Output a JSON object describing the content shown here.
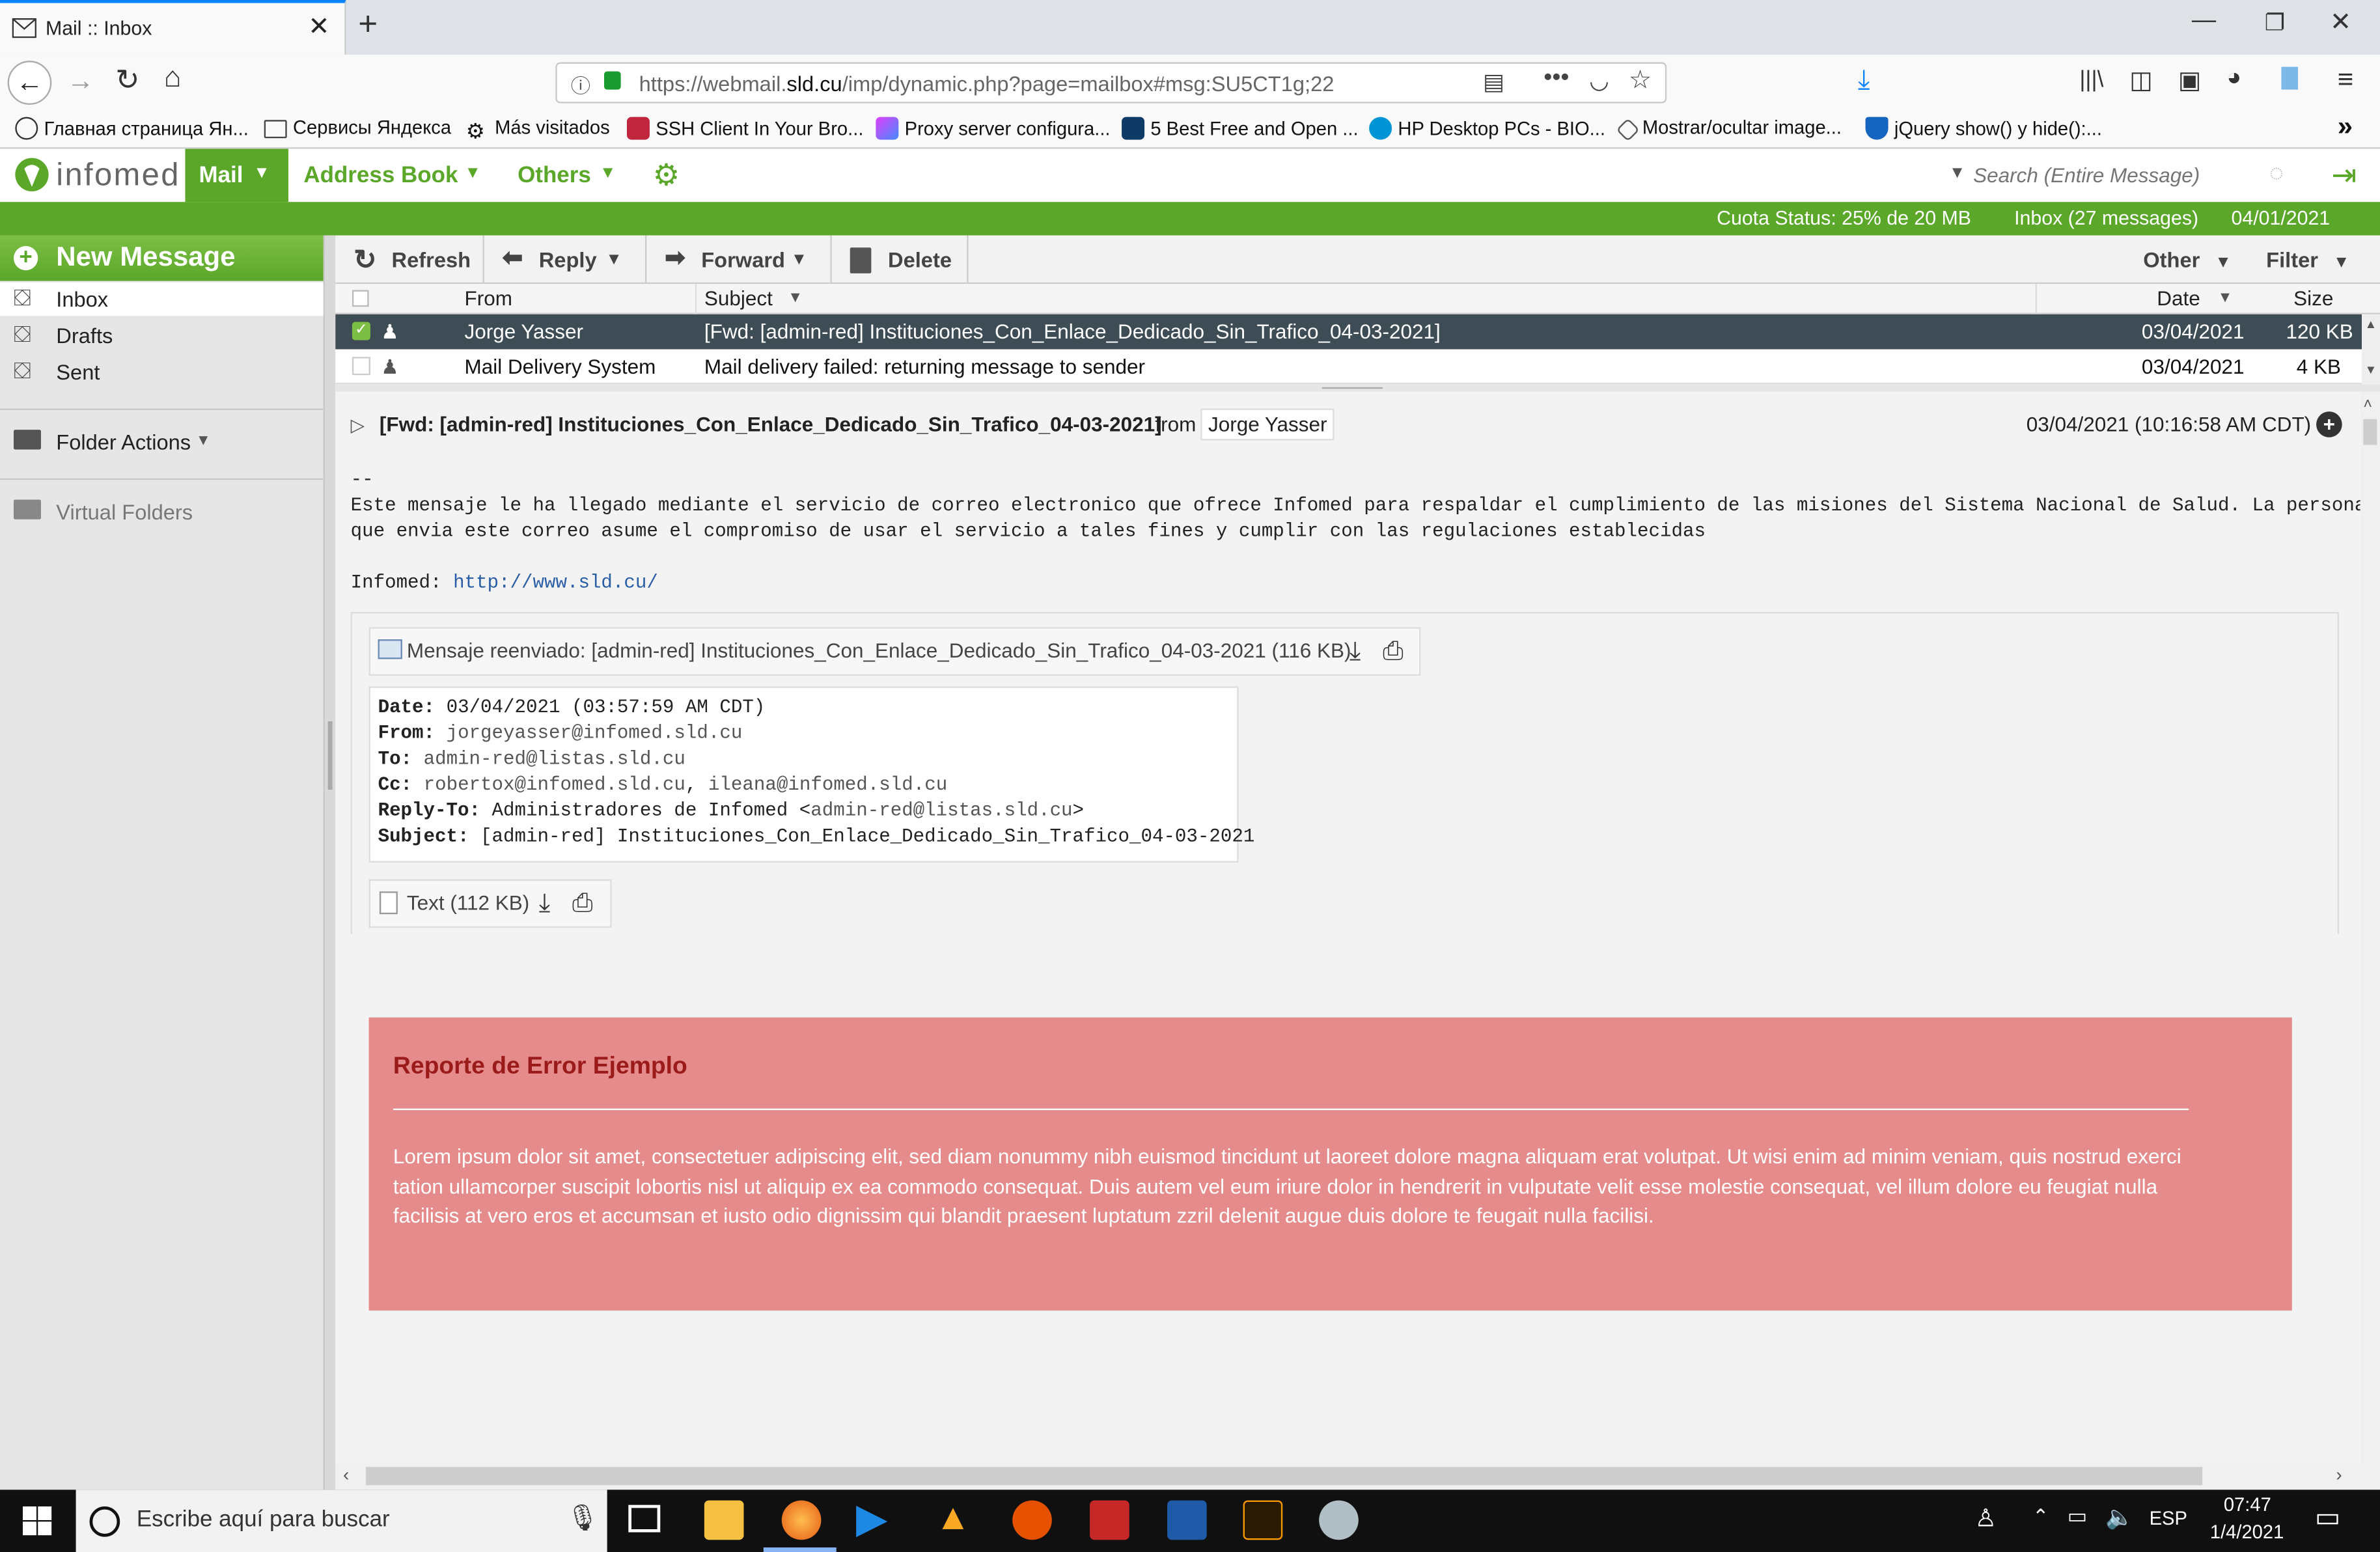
{
  "browser": {
    "tab_title": "Mail :: Inbox",
    "url_host_prefix": "https://webmail.",
    "url_host": "sld.cu",
    "url_path": "/imp/dynamic.php?page=mailbox#msg:SU5CT1g;22",
    "bookmarks": [
      "Главная страница Ян...",
      "Сервисы Яндекса",
      "Más visitados",
      "SSH Client In Your Bro...",
      "Proxy server configura...",
      "5 Best Free and Open ...",
      "HP Desktop PCs - BIO...",
      "Mostrar/ocultar image...",
      "jQuery show() y hide():..."
    ],
    "more_bookmarks": "»"
  },
  "app": {
    "logo_text": "infomed",
    "menu": [
      "Mail",
      "Address Book",
      "Others"
    ],
    "search_placeholder": "Search (Entire Message)",
    "status": {
      "quota": "Cuota Status: 25% de 20 MB",
      "inbox": "Inbox (27 messages)",
      "date": "04/01/2021"
    }
  },
  "sidebar": {
    "new_message": "New Message",
    "folders": [
      "Inbox",
      "Drafts",
      "Sent"
    ],
    "folder_actions": "Folder Actions",
    "virtual_folders": "Virtual Folders"
  },
  "toolbar": {
    "refresh": "Refresh",
    "reply": "Reply",
    "forward": "Forward",
    "delete": "Delete",
    "other": "Other",
    "filter": "Filter"
  },
  "list": {
    "columns": {
      "from": "From",
      "subject": "Subject",
      "date": "Date",
      "size": "Size"
    },
    "rows": [
      {
        "from": "Jorge Yasser",
        "subject": "[Fwd: [admin-red] Instituciones_Con_Enlace_Dedicado_Sin_Trafico_04-03-2021]",
        "date": "03/04/2021",
        "size": "120 KB",
        "selected": true
      },
      {
        "from": "Mail Delivery System",
        "subject": "Mail delivery failed: returning message to sender",
        "date": "03/04/2021",
        "size": "4 KB",
        "selected": false
      }
    ]
  },
  "message": {
    "subject": "[Fwd: [admin-red] Instituciones_Con_Enlace_Dedicado_Sin_Trafico_04-03-2021]",
    "from_label": "from",
    "from": "Jorge Yasser",
    "datetime": "03/04/2021 (10:16:58 AM CDT)",
    "sig_dash": "--",
    "disclaimer_1": "Este mensaje le ha llegado mediante el servicio de correo electronico que ofrece Infomed para respaldar el cumplimiento de las misiones del Sistema Nacional de Salud. La persona",
    "disclaimer_2": "que envia este correo asume el compromiso de usar el servicio a tales fines y cumplir con las regulaciones establecidas",
    "infomed_label": "Infomed:",
    "infomed_url": "http://www.sld.cu/",
    "forwarded_attachment": "Mensaje reenviado: [admin-red] Instituciones_Con_Enlace_Dedicado_Sin_Trafico_04-03-2021 (116 KB)",
    "fwd_headers": {
      "date_label": "Date:",
      "date": "03/04/2021 (03:57:59 AM CDT)",
      "from_label": "From:",
      "from": "jorgeyasser@infomed.sld.cu",
      "to_label": "To:",
      "to": "admin-red@listas.sld.cu",
      "cc_label": "Cc:",
      "cc_1": "robertox@infomed.sld.cu",
      "cc_sep": ",",
      "cc_2": "ileana@infomed.sld.cu",
      "replyto_label": "Reply-To:",
      "replyto_name": "Administradores de Infomed <",
      "replyto_email": "admin-red@listas.sld.cu",
      "replyto_end": ">",
      "subject_label": "Subject:",
      "subject": "[admin-red] Instituciones_Con_Enlace_Dedicado_Sin_Trafico_04-03-2021"
    },
    "text_attachment": "Text (112 KB)",
    "error_title": "Reporte de Error Ejemplo",
    "error_body": "Lorem ipsum dolor sit amet, consectetuer adipiscing elit, sed diam nonummy nibh euismod tincidunt ut laoreet dolore magna aliquam erat volutpat. Ut wisi enim ad minim veniam, quis nostrud exerci tation ullamcorper suscipit lobortis nisl ut aliquip ex ea commodo consequat. Duis autem vel eum iriure dolor in hendrerit in vulputate velit esse molestie consequat, vel illum dolore eu feugiat nulla facilisis at vero eros et accumsan et iusto odio dignissim qui blandit praesent luptatum zzril delenit augue duis dolore te feugait nulla facilisi."
  },
  "taskbar": {
    "search_placeholder": "Escribe aquí para buscar",
    "lang": "ESP",
    "time": "07:47",
    "date": "1/4/2021"
  },
  "colors": {
    "green": "#5aa72a",
    "selected_row": "#3e4d55",
    "error_bg": "#e58b8b",
    "error_title": "#9b1b1b"
  }
}
